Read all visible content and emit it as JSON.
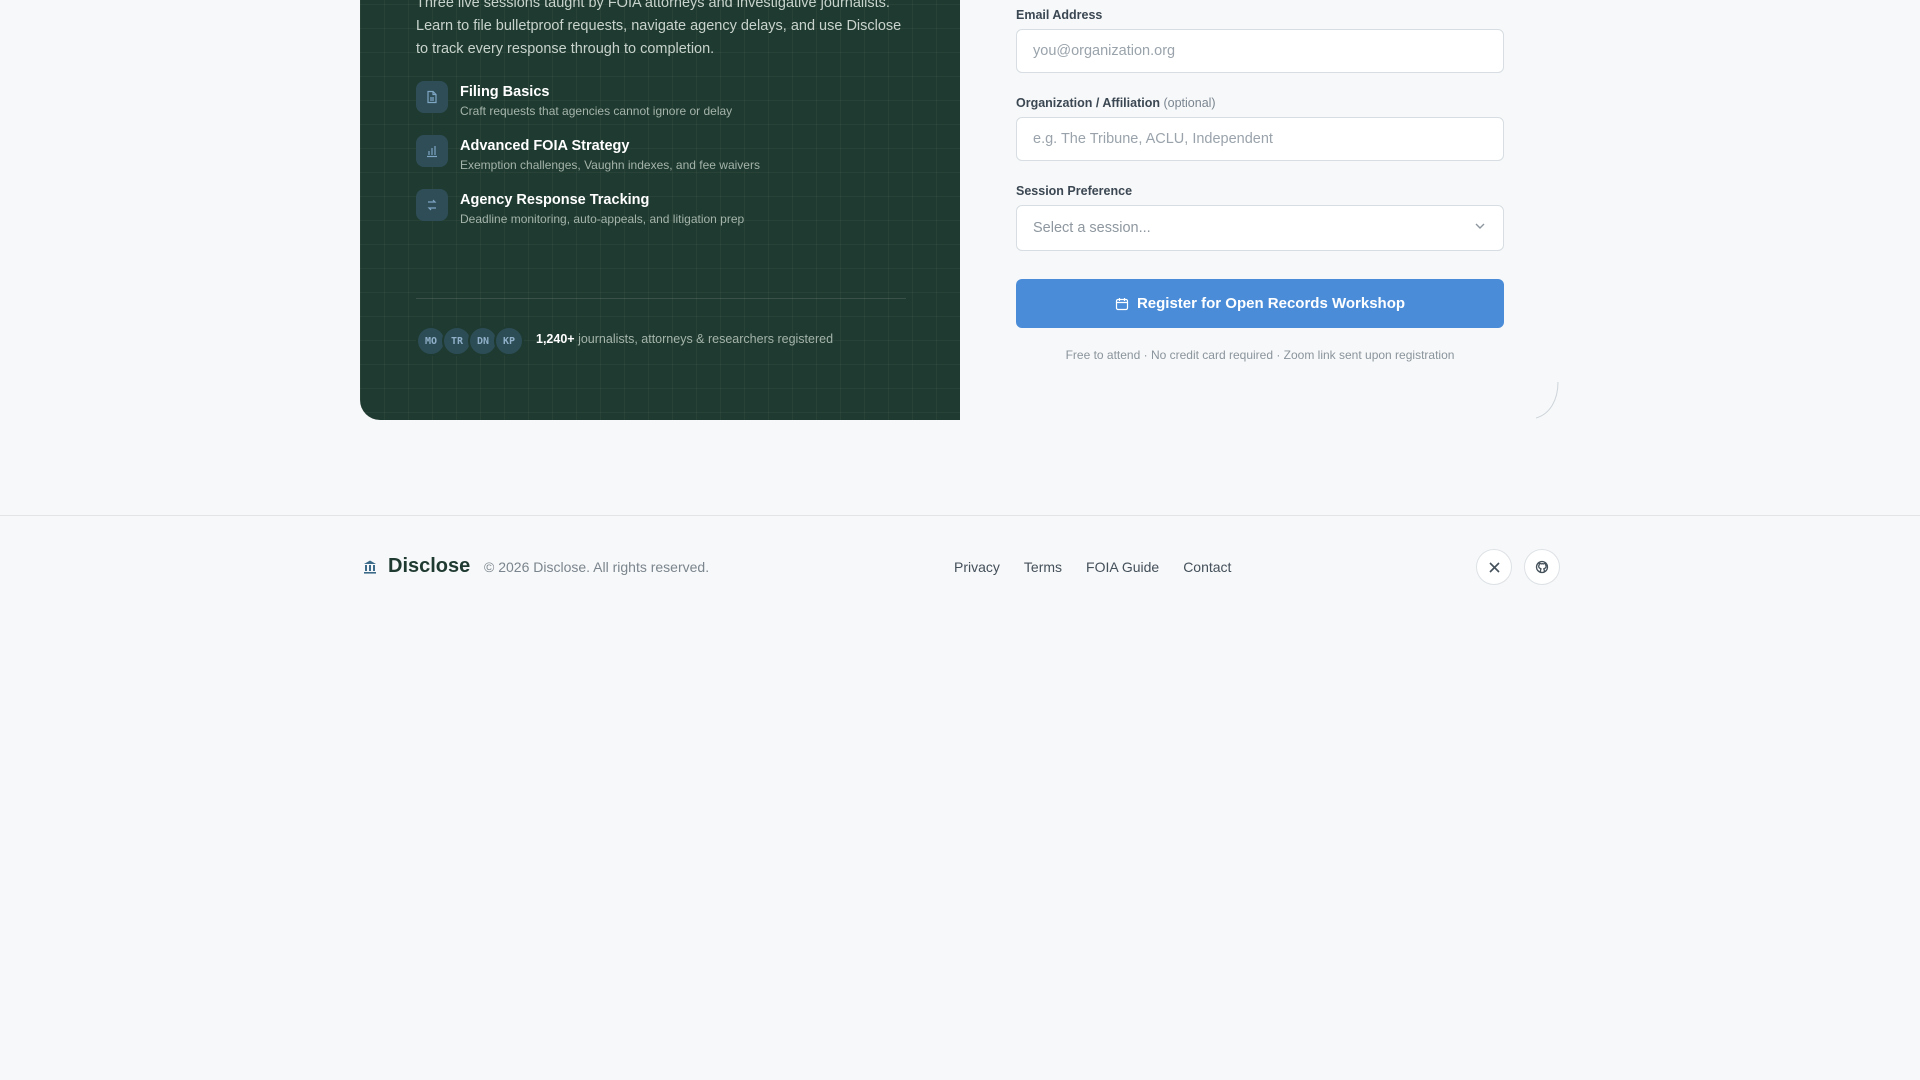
{
  "hero": {
    "intro": "Three live sessions taught by FOIA attorneys and investigative journalists. Learn to file bulletproof requests, navigate agency delays, and use Disclose to track every response through to completion.",
    "features": [
      {
        "title": "Filing Basics",
        "desc": "Craft requests that agencies cannot ignore or delay",
        "icon": "document-icon"
      },
      {
        "title": "Advanced FOIA Strategy",
        "desc": "Exemption challenges, Vaughn indexes, and fee waivers",
        "icon": "bar-chart-icon"
      },
      {
        "title": "Agency Response Tracking",
        "desc": "Deadline monitoring, auto-appeals, and litigation prep",
        "icon": "refresh-icon"
      }
    ],
    "avatars": [
      "MO",
      "TR",
      "DN",
      "KP"
    ],
    "registered_count": "1,240+",
    "registered_text": " journalists, attorneys & researchers registered"
  },
  "form": {
    "email_label": "Email Address",
    "email_placeholder": "you@organization.org",
    "org_label": "Organization / Affiliation",
    "org_optional": "(optional)",
    "org_placeholder": "e.g. The Tribune, ACLU, Independent",
    "session_label": "Session Preference",
    "session_value": "Select a session...",
    "submit_label": "Register for Open Records Workshop",
    "fine_print": "Free to attend · No credit card required · Zoom link sent upon registration"
  },
  "footer": {
    "brand": "Disclose",
    "copyright": "© 2026 Disclose. All rights reserved.",
    "links": [
      "Privacy",
      "Terms",
      "FOIA Guide",
      "Contact"
    ],
    "social": [
      "x-icon",
      "github-icon"
    ]
  },
  "colors": {
    "panel": "#1f3a30",
    "accent": "#4a8cd8",
    "page_bg": "#f7f8f9"
  }
}
